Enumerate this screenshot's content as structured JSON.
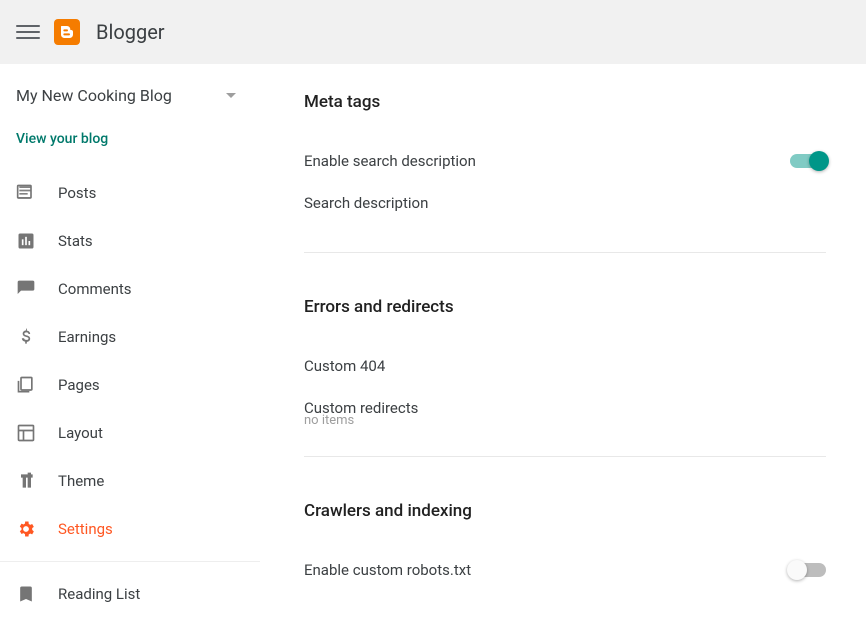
{
  "header": {
    "app_name": "Blogger"
  },
  "sidebar": {
    "blog_name": "My New Cooking Blog",
    "view_link": "View your blog",
    "items": [
      {
        "label": "Posts"
      },
      {
        "label": "Stats"
      },
      {
        "label": "Comments"
      },
      {
        "label": "Earnings"
      },
      {
        "label": "Pages"
      },
      {
        "label": "Layout"
      },
      {
        "label": "Theme"
      },
      {
        "label": "Settings"
      },
      {
        "label": "Reading List"
      }
    ]
  },
  "content": {
    "meta_tags": {
      "title": "Meta tags",
      "enable_search_desc": "Enable search description",
      "search_desc": "Search description"
    },
    "errors": {
      "title": "Errors and redirects",
      "custom_404": "Custom 404",
      "custom_redirects": "Custom redirects",
      "no_items": "no items"
    },
    "crawlers": {
      "title": "Crawlers and indexing",
      "enable_robots": "Enable custom robots.txt"
    }
  }
}
